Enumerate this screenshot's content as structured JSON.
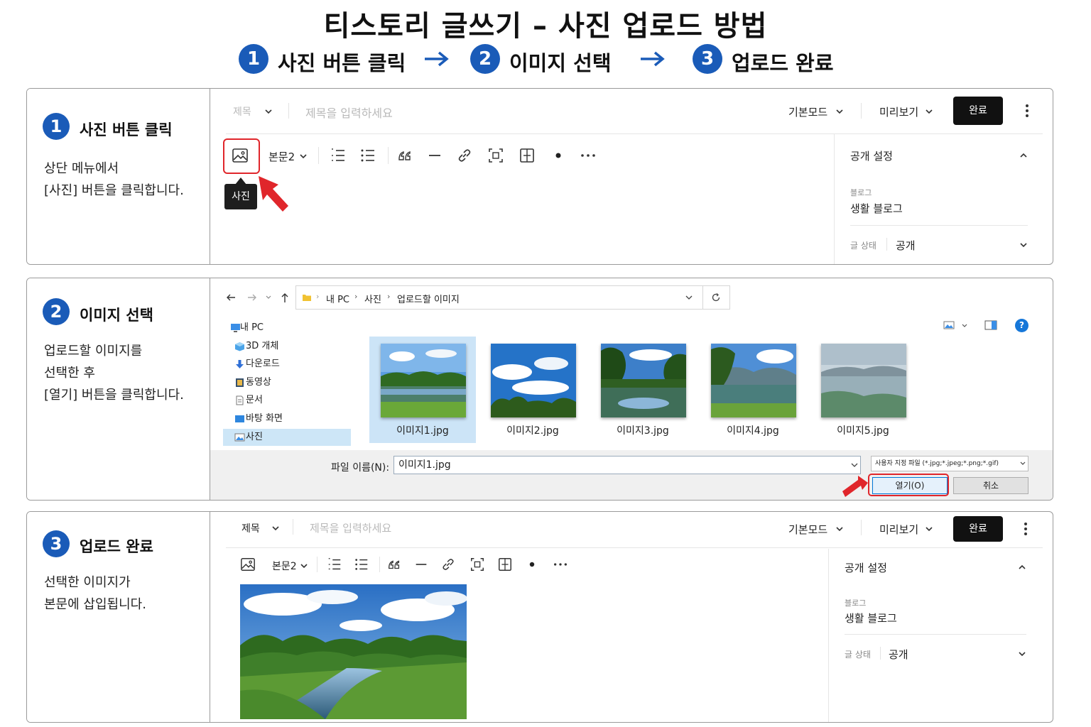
{
  "title": "티스토리 글쓰기 – 사진 업로드 방법",
  "steps": [
    {
      "number": "1",
      "label": "사진 버튼 클릭"
    },
    {
      "number": "2",
      "label": "이미지 선택"
    },
    {
      "number": "3",
      "label": "업로드 완료"
    }
  ],
  "panels": [
    {
      "number": "1",
      "title": "사진 버튼 클릭",
      "desc": [
        "상단 메뉴에서",
        "[사진] 버튼을 클릭합니다."
      ]
    },
    {
      "number": "2",
      "title": "이미지 선택",
      "desc": [
        "업로드할 이미지를",
        "선택한 후",
        "[열기] 버튼을 클릭합니다."
      ]
    },
    {
      "number": "3",
      "title": "업로드 완료",
      "desc": [
        "선택한 이미지가",
        "본문에 삽입됩니다."
      ]
    }
  ],
  "editor": {
    "category_label": "제목",
    "title_placeholder": "제목을 입력하세요",
    "mode_label": "기본모드",
    "preview_label": "미리보기",
    "done_label": "완료",
    "paragraph_style": "본문2",
    "photo_tooltip": "사진",
    "sidebar": {
      "section_title": "공개 설정",
      "blog_label": "블로그",
      "blog_value": "생활 블로그",
      "status_label": "글 상태",
      "status_value": "공개"
    }
  },
  "file_dialog": {
    "breadcrumb": [
      "내 PC",
      "사진",
      "업로드할 이미지"
    ],
    "nav": [
      {
        "label": "내 PC",
        "icon": "computer-icon"
      },
      {
        "label": "3D 개체",
        "icon": "cube-icon"
      },
      {
        "label": "다운로드",
        "icon": "download-icon"
      },
      {
        "label": "동영상",
        "icon": "video-icon"
      },
      {
        "label": "문서",
        "icon": "document-icon"
      },
      {
        "label": "바탕 화면",
        "icon": "desktop-icon"
      },
      {
        "label": "사진",
        "icon": "pictures-icon",
        "selected": true
      }
    ],
    "files": [
      "이미지1.jpg",
      "이미지2.jpg",
      "이미지3.jpg",
      "이미지4.jpg",
      "이미지5.jpg"
    ],
    "selected_file_index": 0,
    "filename_label": "파일 이름(N):",
    "filename_value": "이미지1.jpg",
    "filter_label": "사용자 지정 파일 (*.jpg;*.jpeg;*.png;*.gif)",
    "open_label": "열기(O)",
    "cancel_label": "취소",
    "help_label": "?"
  },
  "colors": {
    "accent_blue": "#1a5bb8",
    "highlight_red": "#e0262b",
    "done_button": "#111111"
  }
}
